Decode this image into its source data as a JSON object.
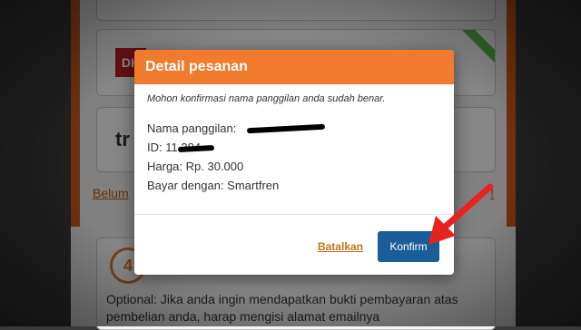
{
  "background": {
    "method_logo_1": "DK",
    "method_logo_2": "tr",
    "link_left": "Belum",
    "link_right": "!",
    "step_number": "4",
    "step_text": "Optional: Jika anda ingin mendapatkan bukti pembayaran atas pembelian anda, harap mengisi alamat emailnya"
  },
  "modal": {
    "title": "Detail pesanan",
    "note": "Mohon konfirmasi nama panggilan anda sudah benar.",
    "nickname_label": "Nama panggilan:",
    "nickname_value": "",
    "id_label": "ID:",
    "id_value": "11 384",
    "price_text": "Harga: Rp. 30.000",
    "pay_text": "Bayar dengan: Smartfren",
    "cancel_label": "Batalkan",
    "confirm_label": "Konfirm"
  },
  "colors": {
    "header": "#f07a2e",
    "confirm_button": "#1a5d97",
    "cancel_link": "#c0761d",
    "arrow": "#e8231f"
  },
  "annotation": {
    "icon": "red-arrow-icon"
  }
}
